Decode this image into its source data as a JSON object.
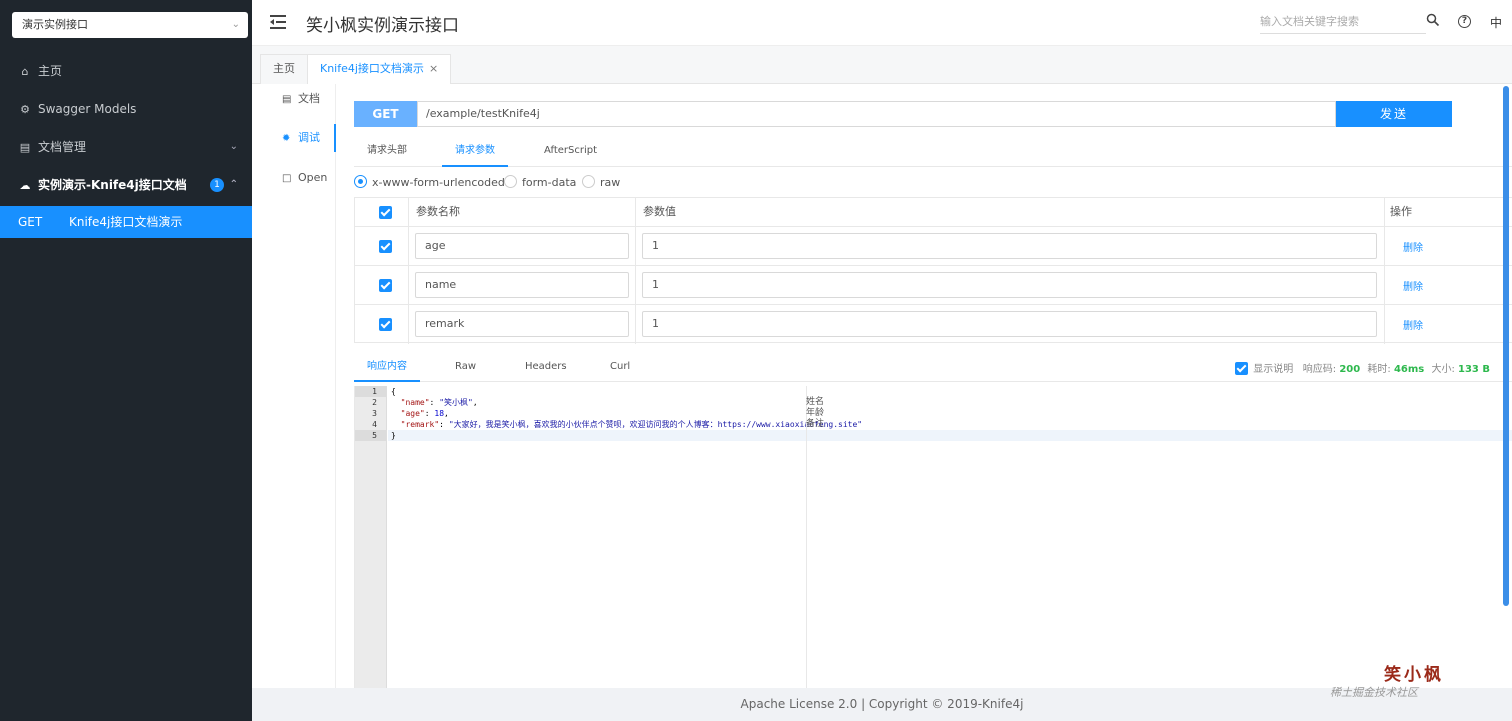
{
  "sidebar": {
    "select_value": "演示实例接口",
    "items": [
      {
        "label": "主页",
        "icon": "home-icon"
      },
      {
        "label": "Swagger Models",
        "icon": "gear-icon"
      },
      {
        "label": "文档管理",
        "icon": "doc-icon"
      },
      {
        "label": "实例演示-Knife4j接口文档",
        "icon": "cloud-icon",
        "badge": "1"
      }
    ],
    "active_item": {
      "method": "GET",
      "label": "Knife4j接口文档演示"
    }
  },
  "header": {
    "title": "笑小枫实例演示接口",
    "search_placeholder": "输入文档关键字搜索",
    "help_glyph": "?",
    "lang": "中"
  },
  "tabs": [
    {
      "label": "主页"
    },
    {
      "label": "Knife4j接口文档演示",
      "close": "×"
    }
  ],
  "vtabs": [
    {
      "label": "文档",
      "icon": "file-icon"
    },
    {
      "label": "调试",
      "icon": "bug-icon"
    },
    {
      "label": "Open",
      "icon": "page-icon"
    }
  ],
  "request": {
    "method": "GET",
    "url": "/example/testKnife4j",
    "send_label": "发送"
  },
  "sub_tabs": [
    "请求头部",
    "请求参数",
    "AfterScript"
  ],
  "body_types": [
    "x-www-form-urlencoded",
    "form-data",
    "raw"
  ],
  "params": {
    "headers": [
      "参数名称",
      "参数值",
      "操作"
    ],
    "rows": [
      {
        "name": "age",
        "value": "1",
        "action": "删除"
      },
      {
        "name": "name",
        "value": "1",
        "action": "删除"
      },
      {
        "name": "remark",
        "value": "1",
        "action": "删除"
      }
    ]
  },
  "response": {
    "tabs": [
      "响应内容",
      "Raw",
      "Headers",
      "Curl"
    ],
    "show_desc_label": "显示说明",
    "status_label": "响应码:",
    "status": "200",
    "time_label": "耗时:",
    "time": "46ms",
    "size_label": "大小:",
    "size": "133 B",
    "line_numbers": [
      "1",
      "2",
      "3",
      "4",
      "5"
    ],
    "code": {
      "open": "{",
      "name_key": "\"name\"",
      "name_val": "\"笑小枫\"",
      "age_key": "\"age\"",
      "age_val": "18",
      "remark_key": "\"remark\"",
      "remark_val": "\"大家好，我是笑小枫，喜欢我的小伙伴点个赞呗，欢迎访问我的个人博客：https://www.xiaoxiaofeng.site\"",
      "close": "}"
    },
    "notes": [
      "姓名",
      "年龄",
      "备注"
    ]
  },
  "footer": {
    "text": "Apache License 2.0 | Copyright © 2019-Knife4j"
  },
  "watermark": {
    "logo": "笑小枫",
    "text": "稀土掘金技术社区"
  },
  "colors": {
    "primary": "#1890ff",
    "sidebar": "#1f262d",
    "success": "#2db84d"
  }
}
